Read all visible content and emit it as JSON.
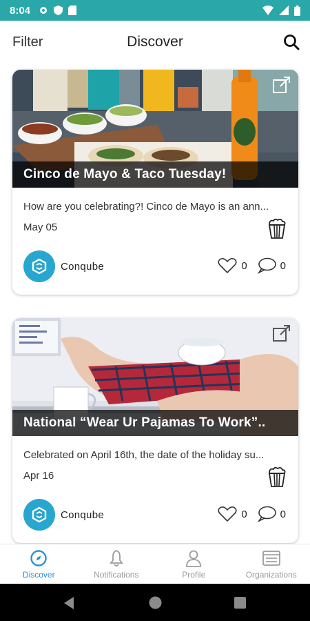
{
  "status_bar": {
    "time": "8:04"
  },
  "header": {
    "filter_label": "Filter",
    "title": "Discover"
  },
  "cards": [
    {
      "title": "Cinco de Mayo & Taco Tuesday!",
      "description": "How are you celebrating?! Cinco de Mayo is an ann...",
      "date": "May 05",
      "org_name": "Conqube",
      "likes": "0",
      "comments": "0"
    },
    {
      "title": "National “Wear Ur Pajamas To Work”..",
      "description": "Celebrated  on April 16th, the date of the holiday su...",
      "date": "Apr 16",
      "org_name": "Conqube",
      "likes": "0",
      "comments": "0"
    }
  ],
  "bottom_nav": [
    {
      "label": "Discover",
      "icon": "compass-icon",
      "active": true
    },
    {
      "label": "Notifications",
      "icon": "bell-icon",
      "active": false
    },
    {
      "label": "Profile",
      "icon": "person-icon",
      "active": false
    },
    {
      "label": "Organizations",
      "icon": "list-icon",
      "active": false
    }
  ],
  "colors": {
    "status_bar": "#2aa7a9",
    "accent": "#2a8fd8",
    "org_logo": "#27a6cf"
  }
}
